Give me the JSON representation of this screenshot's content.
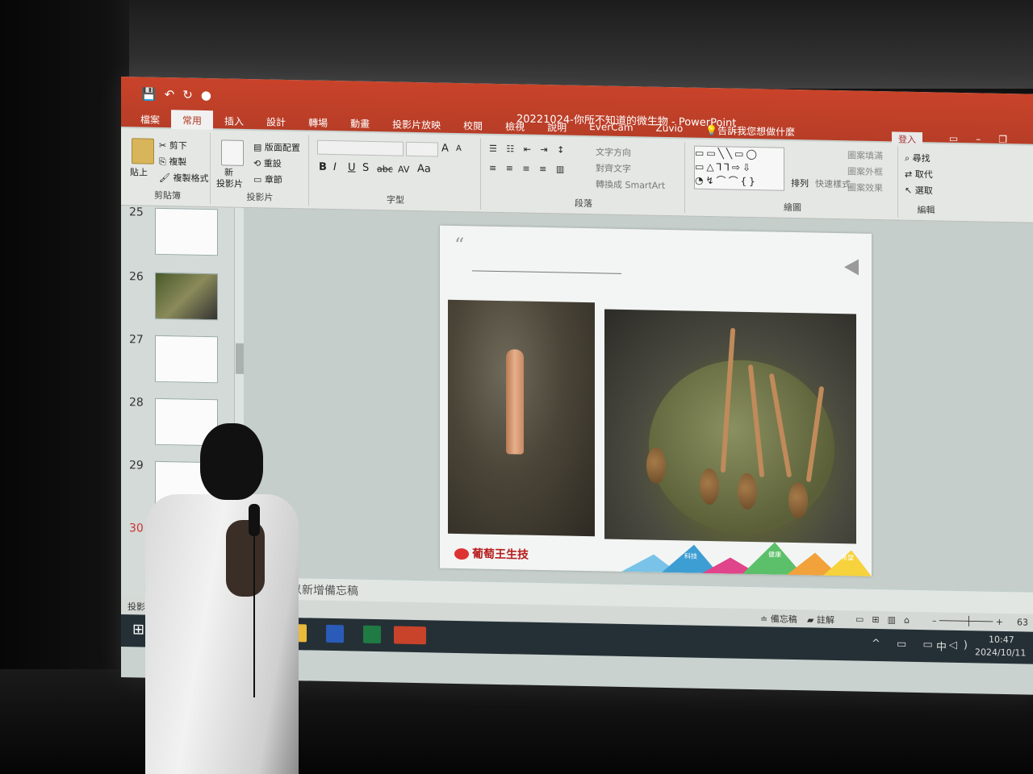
{
  "powerpoint": {
    "title": "20221024-你所不知道的微生物 - PowerPoint",
    "login_label": "登入",
    "tabs": [
      "檔案",
      "常用",
      "插入",
      "設計",
      "轉場",
      "動畫",
      "投影片放映",
      "校閱",
      "檢視",
      "說明",
      "EverCam",
      "Zuvio",
      "告訴我您想做什麼"
    ],
    "active_tab": "常用",
    "ribbon": {
      "clipboard": {
        "paste": "貼上",
        "cut": "剪下",
        "copy": "複製",
        "format_painter": "複製格式",
        "label": "剪貼簿"
      },
      "slides": {
        "new": "新",
        "new2": "投影片",
        "layout": "版面配置",
        "reset": "重設",
        "section": "章節",
        "label": "投影片"
      },
      "font": {
        "label": "字型",
        "bold": "B",
        "italic": "I",
        "underline": "U",
        "shadow": "S",
        "strike": "abc",
        "spacing": "AV",
        "case": "Aa",
        "grow": "A",
        "shrink": "A"
      },
      "paragraph": {
        "label": "段落",
        "text_direction": "文字方向",
        "align_text": "對齊文字",
        "convert_smartart": "轉換成 SmartArt"
      },
      "drawing": {
        "label": "繪圖",
        "arrange": "排列",
        "quick_styles": "快速樣式",
        "fill": "圖案填滿",
        "outline": "圖案外框",
        "effects": "圖案效果"
      },
      "editing": {
        "label": "編輯",
        "find": "尋找",
        "replace": "取代",
        "select": "選取"
      }
    },
    "thumbnails": [
      "25",
      "26",
      "27",
      "28",
      "29",
      "30"
    ],
    "notes_placeholder": "以新增備忘稿",
    "status": {
      "slide_info": "投影片",
      "notes": "備忘稿",
      "comments": "註解",
      "zoom": "63"
    }
  },
  "slide": {
    "quote_mark": "“",
    "logo_text": "葡萄王生技",
    "banner_words": [
      "科技",
      "健康",
      "希望"
    ]
  },
  "taskbar": {
    "ime": "中",
    "time": "10:47",
    "date": "2024/10/11"
  },
  "colors": {
    "titlebar": "#c9432a",
    "slide_bg": "#f3f5f4",
    "logo_red": "#b71d1d"
  }
}
